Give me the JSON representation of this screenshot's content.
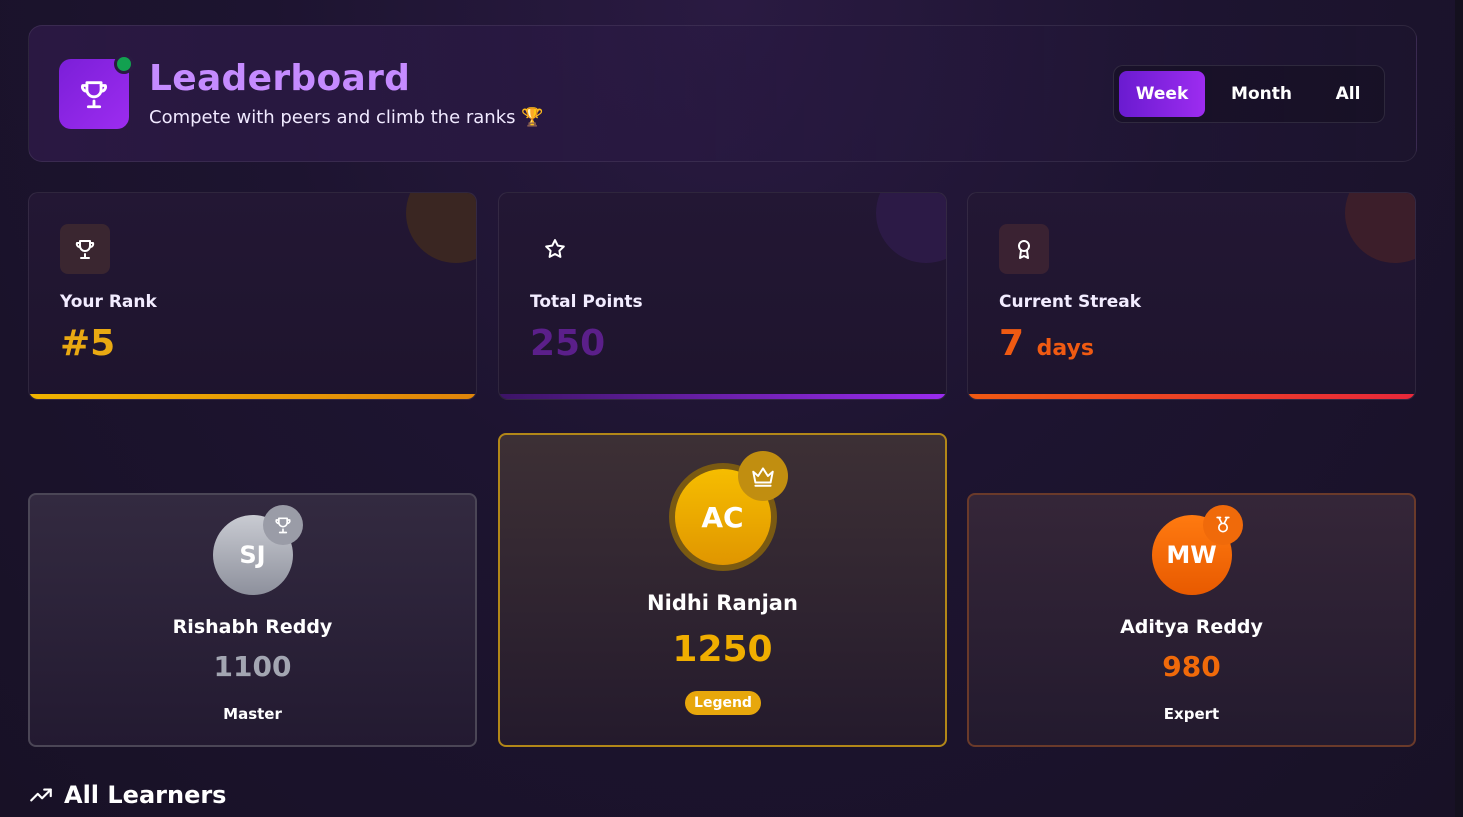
{
  "header": {
    "title": "Leaderboard",
    "subtitle": "Compete with peers and climb the ranks 🏆",
    "logo_icon": "trophy-icon",
    "status": "online"
  },
  "period_toggle": {
    "options": [
      "Week",
      "Month",
      "All"
    ],
    "selected": "Week"
  },
  "stats": [
    {
      "label": "Your Rank",
      "value": "#5",
      "icon": "trophy-icon",
      "color": "#e9a912"
    },
    {
      "label": "Total Points",
      "value": "250",
      "icon": "star-icon",
      "color": "#5b1f8a"
    },
    {
      "label": "Current Streak",
      "value": "7",
      "unit": "days",
      "icon": "award-icon",
      "color": "#f05a12"
    }
  ],
  "podium": {
    "first": {
      "initials": "AC",
      "name": "Nidhi Ranjan",
      "points": "1250",
      "tier": "Legend",
      "icon": "crown-icon",
      "color": "#f0ae00"
    },
    "second": {
      "initials": "SJ",
      "name": "Rishabh Reddy",
      "points": "1100",
      "tier": "Master",
      "icon": "trophy-icon",
      "color": "#a3a6b2"
    },
    "third": {
      "initials": "MW",
      "name": "Aditya Reddy",
      "points": "980",
      "tier": "Expert",
      "icon": "medal-icon",
      "color": "#f06a0a"
    }
  },
  "all_learners": {
    "title": "All Learners",
    "icon": "trending-up-icon"
  }
}
